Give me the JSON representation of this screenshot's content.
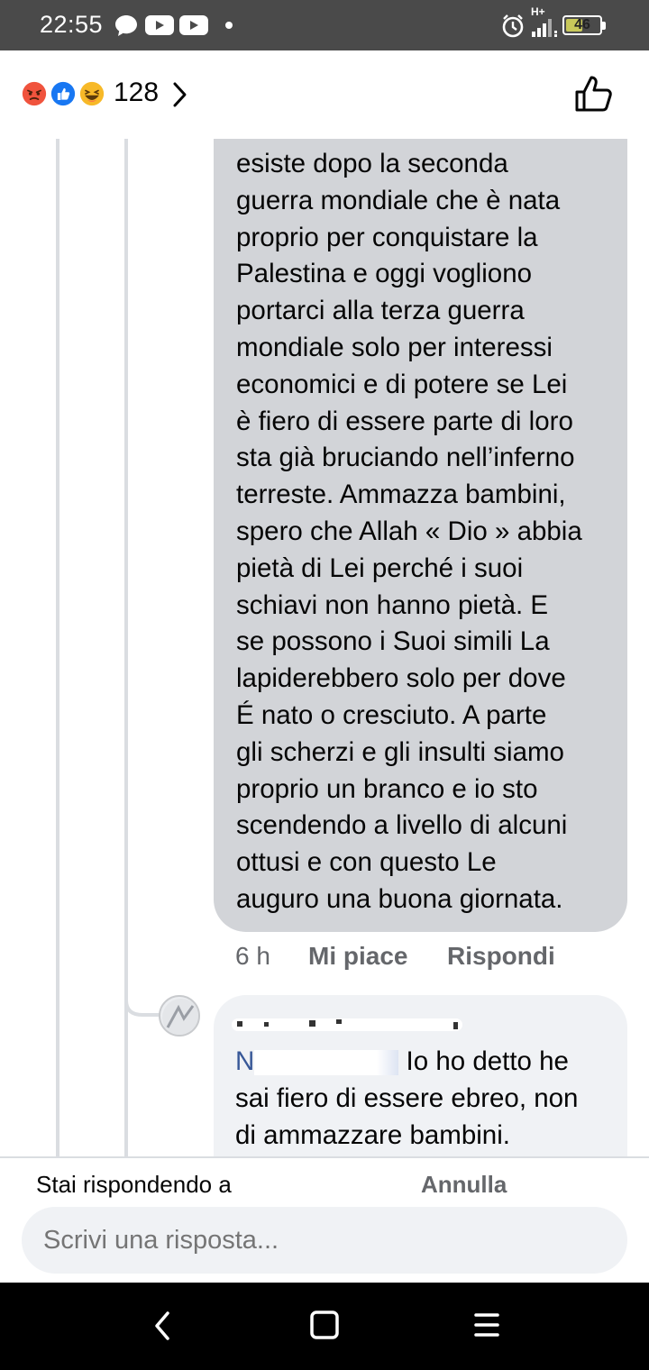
{
  "status_bar": {
    "time": "22:55",
    "network_label": "H+",
    "battery_level": "46",
    "icons": [
      "message-bubble-icon",
      "youtube-icon",
      "youtube-icon",
      "dot-icon",
      "alarm-icon",
      "signal-icon",
      "battery-icon"
    ]
  },
  "reactions": {
    "icons": [
      "angry-reaction-icon",
      "like-reaction-icon",
      "haha-reaction-icon"
    ],
    "count": "128",
    "colors": {
      "angry": "#f0533d",
      "like": "#1877f2",
      "haha": "#f7b928"
    }
  },
  "comment": {
    "lines": [
      "esiste dopo la seconda",
      "guerra mondiale che è nata",
      "proprio per conquistare la",
      "Palestina e oggi vogliono",
      "portarci alla terza guerra",
      "mondiale solo per interessi",
      "economici e di potere se Lei",
      "è fiero di essere parte di loro",
      "sta già bruciando nell’inferno",
      "terreste. Ammazza bambini,",
      "spero che Allah « Dio » abbia",
      "pietà di Lei perché i suoi",
      "schiavi non hanno pietà. E",
      "se possono i Suoi simili La",
      "lapiderebbero solo per dove",
      "É nato o cresciuto. A parte",
      "gli scherzi e gli insulti siamo",
      "proprio un branco e io sto",
      "scendendo a livello di alcuni",
      "ottusi e con questo Le",
      "auguro una buona giornata."
    ],
    "time": "6 h",
    "like_label": "Mi piace",
    "reply_label": "Rispondi"
  },
  "reply": {
    "mention": "N",
    "text_first": "Io ho detto  he",
    "text_lines": [
      "sai fiero di essere ebreo, non",
      "di ammazzare bambini."
    ]
  },
  "reply_bar": {
    "replying_to_label": "Stai rispondendo a",
    "cancel_label": "Annulla",
    "input_placeholder": "Scrivi una risposta..."
  },
  "colors": {
    "status_bar_bg": "#4a4a4a",
    "bubble_bg": "#d2d4d8",
    "reply_bubble_bg": "#f0f2f5",
    "secondary_text": "#65676b",
    "mention": "#385898"
  }
}
